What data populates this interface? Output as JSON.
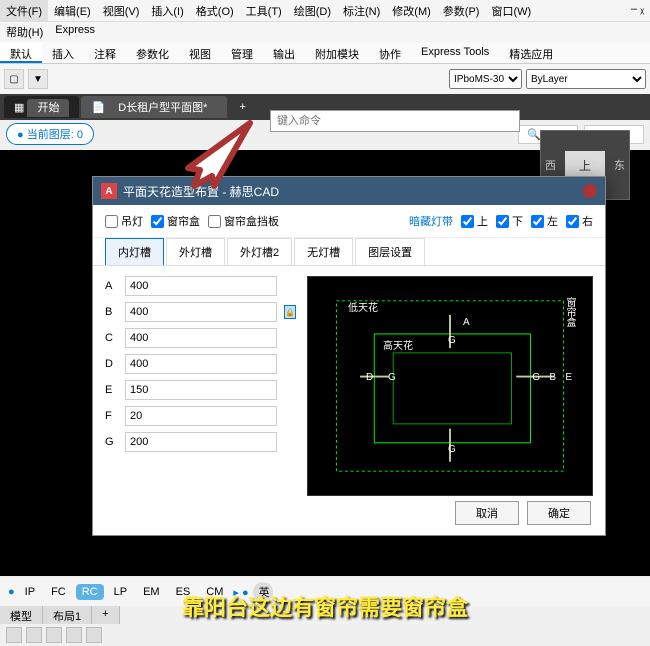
{
  "menu": [
    "文件(F)",
    "编辑(E)",
    "视图(V)",
    "插入(I)",
    "格式(O)",
    "工具(T)",
    "绘图(D)",
    "标注(N)",
    "修改(M)",
    "参数(P)",
    "窗口(W)"
  ],
  "help_row": [
    "帮助(H)",
    "Express"
  ],
  "win_ctrl": "‒ ᵪ",
  "ribbon": [
    "默认",
    "插入",
    "注释",
    "参数化",
    "视图",
    "管理",
    "输出",
    "附加模块",
    "协作",
    "Express Tools",
    "精选应用"
  ],
  "toolbar2": {
    "combo1": "IPboMS-30",
    "combo2": "ByLayer"
  },
  "doc_tabs": {
    "start": "开始",
    "doc": "D长租户型平面图*"
  },
  "layer": {
    "label": "当前图层: 0",
    "count": "0"
  },
  "cmd_placeholder": "键入命令",
  "nav": {
    "w": "西",
    "top": "上",
    "e": "东"
  },
  "dialog": {
    "title": "平面天花造型布置 - 赫思CAD",
    "opts": {
      "hang": "吊灯",
      "box": "窗帘盒",
      "baffle": "窗帘盒挡板",
      "hidden": "暗藏灯带",
      "up": "上",
      "down": "下",
      "left": "左",
      "right": "右"
    },
    "tabs": [
      "内灯槽",
      "外灯槽",
      "外灯槽2",
      "无灯槽",
      "图层设置"
    ],
    "fields": {
      "A": "400",
      "B": "400",
      "C": "400",
      "D": "400",
      "E": "150",
      "F": "20",
      "G": "200"
    },
    "preview": {
      "low": "低天花",
      "high": "高天花",
      "curtain": "窗帘盒",
      "d": "D",
      "g": "G",
      "a": "A",
      "b": "B",
      "e": "E"
    },
    "btn_cancel": "取消",
    "btn_ok": "确定"
  },
  "status": [
    "IP",
    "FC",
    "RC",
    "LP",
    "EM",
    "ES",
    "CM"
  ],
  "status_lang": "英",
  "bottom_tabs": [
    "模型",
    "布局1"
  ],
  "subtitle": "靠阳台这边有窗帘需要窗帘盒"
}
